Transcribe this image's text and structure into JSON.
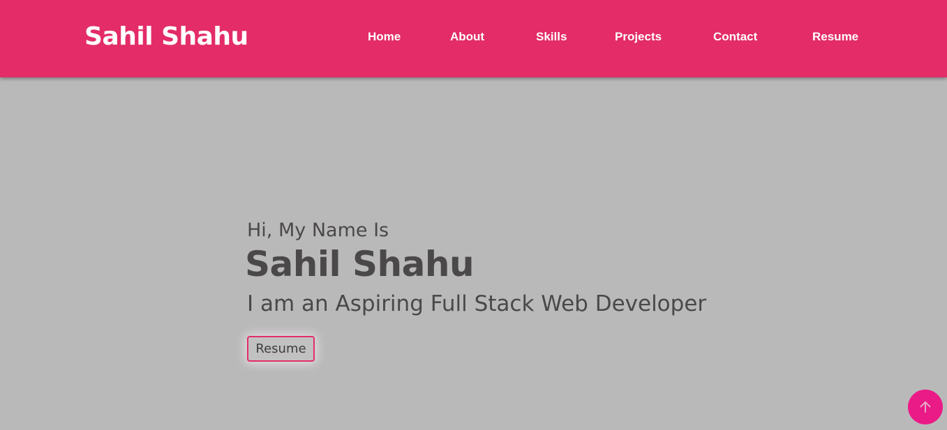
{
  "navbar": {
    "logo": "Sahil Shahu",
    "links": [
      {
        "label": "Home"
      },
      {
        "label": "About"
      },
      {
        "label": "Skills"
      },
      {
        "label": "Projects"
      },
      {
        "label": "Contact"
      },
      {
        "label": "Resume"
      }
    ]
  },
  "hero": {
    "greeting": "Hi, My Name Is",
    "name": "Sahil Shahu",
    "tagline": "I am an Aspiring Full Stack Web Developer",
    "resume_button": "Resume"
  },
  "scroll_top": {
    "icon": "arrow-up-icon"
  },
  "colors": {
    "brand": "#e32c68",
    "background": "#bab9ba",
    "text": "#4a4848",
    "scroll_button": "#ea1a86"
  }
}
